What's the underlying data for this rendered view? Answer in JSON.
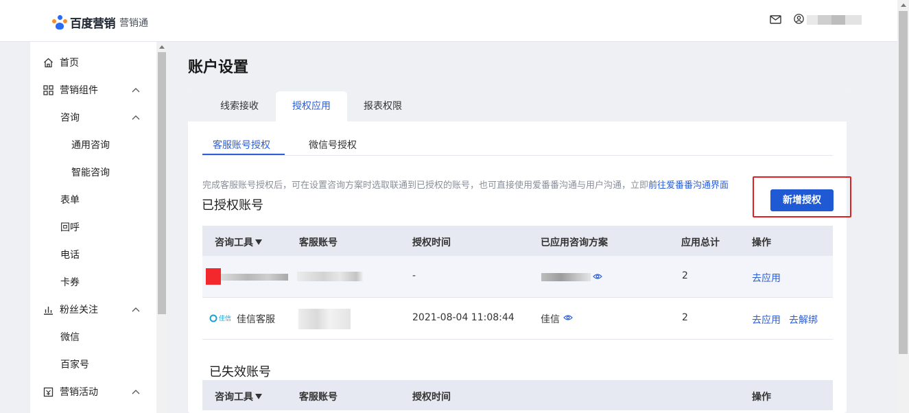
{
  "header": {
    "brand": "百度营销",
    "product": "营销通",
    "mail_icon": "mail-icon",
    "user_icon": "user-icon"
  },
  "sidebar": {
    "items": [
      {
        "label": "首页",
        "icon": "home-icon",
        "level": 1,
        "chevron": false
      },
      {
        "label": "营销组件",
        "icon": "grid-icon",
        "level": 1,
        "chevron": true
      },
      {
        "label": "咨询",
        "icon": "",
        "level": 2,
        "chevron": true
      },
      {
        "label": "通用咨询",
        "icon": "",
        "level": 3,
        "chevron": false
      },
      {
        "label": "智能咨询",
        "icon": "",
        "level": 3,
        "chevron": false
      },
      {
        "label": "表单",
        "icon": "",
        "level": 2,
        "chevron": false
      },
      {
        "label": "回呼",
        "icon": "",
        "level": 2,
        "chevron": false
      },
      {
        "label": "电话",
        "icon": "",
        "level": 2,
        "chevron": false
      },
      {
        "label": "卡券",
        "icon": "",
        "level": 2,
        "chevron": false
      },
      {
        "label": "粉丝关注",
        "icon": "bar-chart-icon",
        "level": 1,
        "chevron": true
      },
      {
        "label": "微信",
        "icon": "",
        "level": 2,
        "chevron": false
      },
      {
        "label": "百家号",
        "icon": "",
        "level": 2,
        "chevron": false
      },
      {
        "label": "营销活动",
        "icon": "gift-icon",
        "level": 1,
        "chevron": true
      }
    ]
  },
  "main": {
    "title": "账户设置",
    "tabs": [
      {
        "label": "线索接收",
        "active": false
      },
      {
        "label": "授权应用",
        "active": true
      },
      {
        "label": "报表权限",
        "active": false
      }
    ],
    "subtabs": [
      {
        "label": "客服账号授权",
        "active": true
      },
      {
        "label": "微信号授权",
        "active": false
      }
    ],
    "hint": "完成客服账号授权后，可在设置咨询方案时选取联通到已授权的账号，也可直接使用爱番番沟通与用户沟通，立即",
    "hint_link": "前往爱番番沟通界面",
    "authorized_title": "已授权账号",
    "add_button": "新增授权",
    "columns": [
      "咨询工具",
      "客服账号",
      "授权时间",
      "已应用咨询方案",
      "应用总计",
      "操作"
    ],
    "rows": [
      {
        "tool": "",
        "account": "",
        "time": "-",
        "plan": "",
        "total": "2",
        "actions": [
          "去应用"
        ]
      },
      {
        "tool_logo": "佳信",
        "tool": "佳信客服",
        "account": "",
        "time": "2021-08-04 11:08:44",
        "plan": "佳信",
        "total": "2",
        "actions": [
          "去应用",
          "去解绑"
        ]
      }
    ],
    "expired_title": "已失效账号",
    "expired_columns": [
      "咨询工具",
      "客服账号",
      "授权时间",
      "操作"
    ]
  },
  "colors": {
    "accent": "#2b5ed6",
    "primary_button": "#1f59d4",
    "highlight": "#e02020"
  }
}
